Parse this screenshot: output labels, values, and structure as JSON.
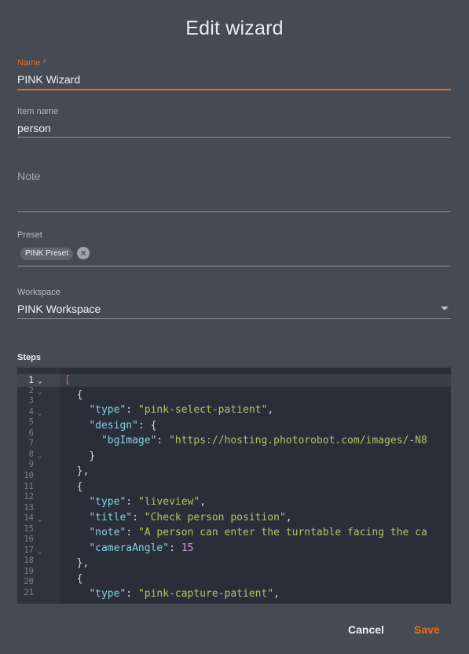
{
  "dialog": {
    "title": "Edit wizard",
    "name_field": {
      "label": "Name *",
      "value": "PINK Wizard"
    },
    "item_name_field": {
      "label": "Item name",
      "value": "person"
    },
    "note_field": {
      "placeholder": "Note",
      "value": ""
    },
    "preset_field": {
      "label": "Preset",
      "chip": "PINK Preset",
      "chip_remove_icon": "close-circle-icon"
    },
    "workspace_field": {
      "label": "Workspace",
      "value": "PINK Workspace",
      "dropdown_icon": "caret-down-icon"
    },
    "steps": {
      "label": "Steps",
      "line_numbers": [
        "1",
        "2",
        "3",
        "4",
        "5",
        "6",
        "7",
        "8",
        "9",
        "10",
        "11",
        "12",
        "13",
        "14",
        "15",
        "16",
        "17",
        "18",
        "19",
        "20",
        "21"
      ],
      "fold_lines": [
        "1",
        "2",
        "4",
        "8",
        "14",
        "17"
      ],
      "active_line": "1",
      "code": {
        "l1": "[",
        "l2": "{",
        "l3_key": "\"type\"",
        "l3_val": "\"pink-select-patient\"",
        "l4_key": "\"design\"",
        "l5_key": "\"bgImage\"",
        "l5_val": "\"https://hosting.photorobot.com/images/-N8",
        "l6": "}",
        "l7": "},",
        "l8": "{",
        "l9_key": "\"type\"",
        "l9_val": "\"liveview\"",
        "l10_key": "\"title\"",
        "l10_val": "\"Check person position\"",
        "l11_key": "\"note\"",
        "l11_val": "\"A person can enter the turntable facing the ca",
        "l12_key": "\"cameraAngle\"",
        "l12_val": "15",
        "l13": "},",
        "l14": "{",
        "l15_key": "\"type\"",
        "l15_val": "\"pink-capture-patient\""
      }
    },
    "actions": {
      "cancel": "Cancel",
      "save": "Save"
    },
    "colors": {
      "accent": "#e8691f",
      "background": "#464a55",
      "editor_bg": "#2a2e38"
    }
  }
}
